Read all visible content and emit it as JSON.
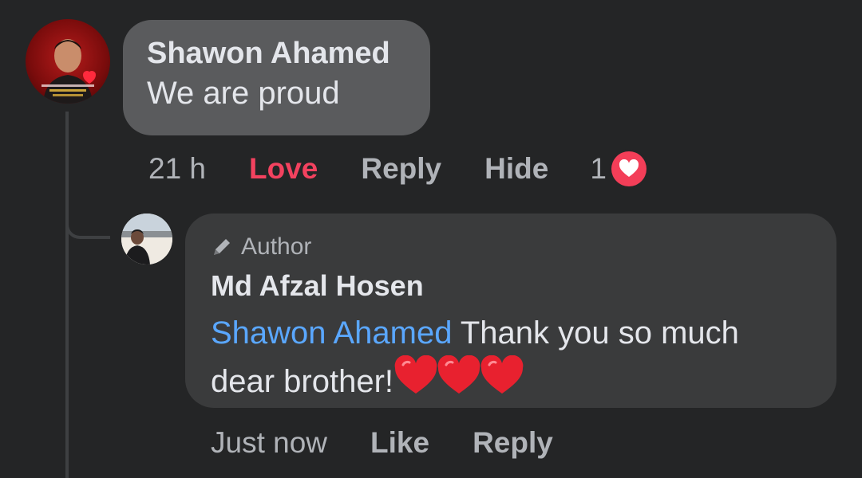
{
  "comment": {
    "author": "Shawon Ahamed",
    "text": "We are proud",
    "avatar_icon": "profile-photo-icon",
    "actions": {
      "time": "21 h",
      "love": "Love",
      "reply": "Reply",
      "hide": "Hide"
    },
    "reaction": {
      "count": "1",
      "icon": "love-reaction-icon",
      "color": "#f33e58"
    }
  },
  "reply": {
    "badge_icon": "pencil-icon",
    "badge": "Author",
    "author": "Md Afzal Hosen",
    "mention": "Shawon Ahamed",
    "text": " Thank you so much dear brother!",
    "emojis": "❤❤❤",
    "actions": {
      "time": "Just now",
      "like": "Like",
      "reply": "Reply"
    }
  },
  "colors": {
    "background": "#242526",
    "comment_bubble": "#5a5b5d",
    "reply_bubble": "#3a3b3c",
    "love_active": "#f3425f",
    "mention": "#5aa7ff",
    "muted_text": "#b0b3b8"
  }
}
